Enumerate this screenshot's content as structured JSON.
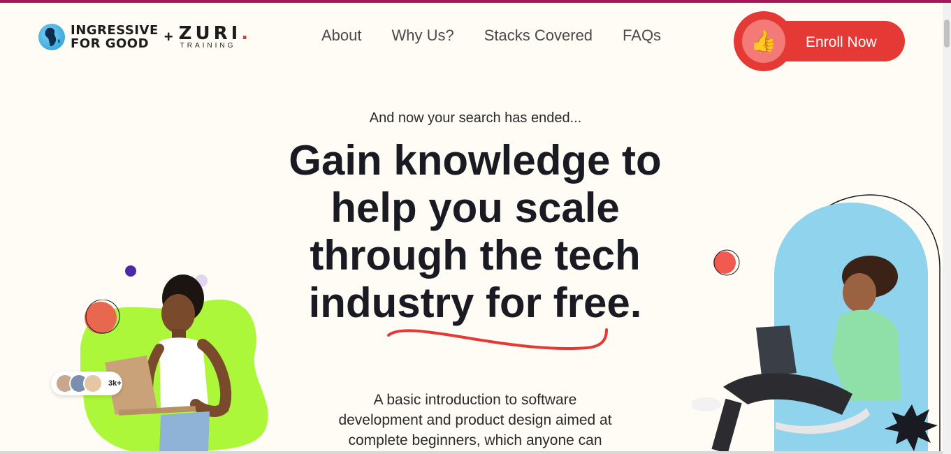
{
  "header": {
    "brand_line1": "INGRESSIVE",
    "brand_line2": "FOR GOOD",
    "plus": "+",
    "zuri": "ZURI",
    "zuri_dot": ".",
    "zuri_sub": "TRAINING",
    "nav": [
      "About",
      "Why Us?",
      "Stacks Covered",
      "FAQs"
    ],
    "enroll_label": "Enroll Now",
    "enroll_icon": "thumbs-up-icon"
  },
  "hero": {
    "tagline": "And now your search has ended...",
    "headline": "Gain knowledge to help you scale through the tech industry for free.",
    "description": "A basic introduction to software development and product design aimed at complete beginners, which anyone can join"
  },
  "social_proof": {
    "count": "3k+"
  },
  "colors": {
    "accent": "#e53935",
    "top_bar": "#a8155a",
    "background": "#fefcf5",
    "blob_green": "#adf73a",
    "sky_blue": "#8fd3ec"
  }
}
